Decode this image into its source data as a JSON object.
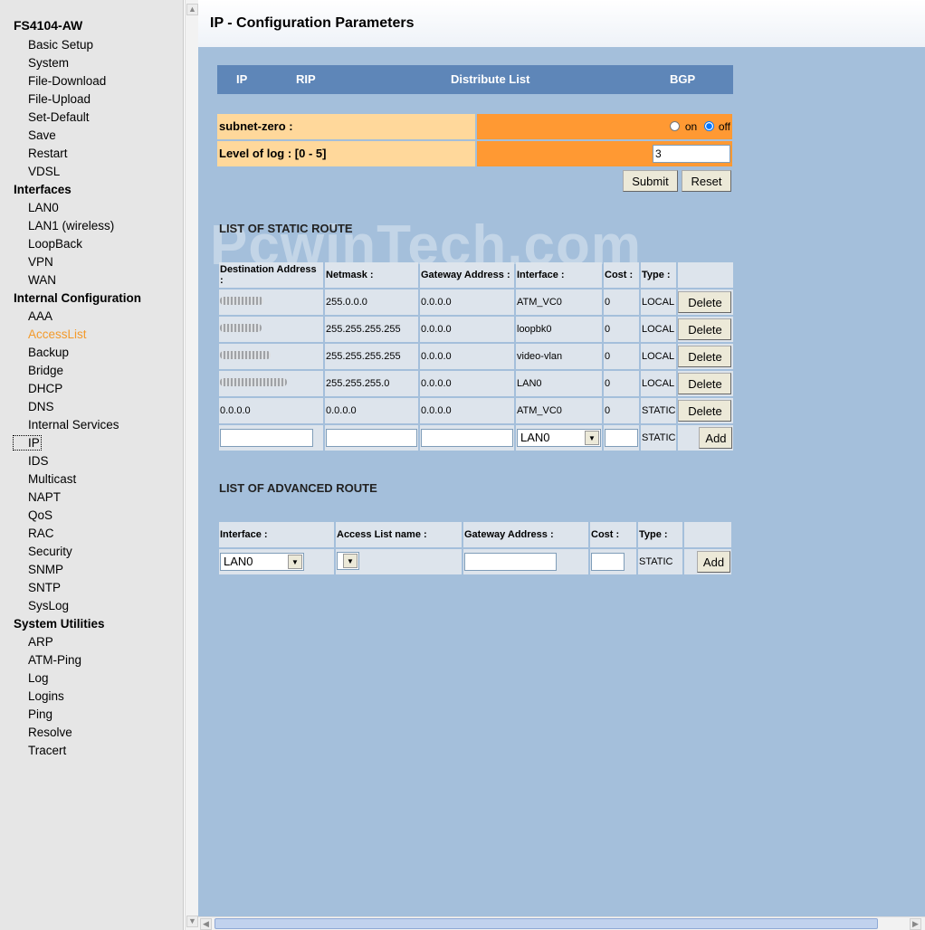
{
  "sidebar": {
    "title": "FS4104-AW",
    "groups": [
      {
        "label": "",
        "items": [
          "Basic Setup",
          "System",
          "File-Download",
          "File-Upload",
          "Set-Default",
          "Save",
          "Restart",
          "VDSL"
        ]
      },
      {
        "label": "Interfaces",
        "items": [
          "LAN0",
          "LAN1 (wireless)",
          "LoopBack",
          "VPN",
          "WAN"
        ]
      },
      {
        "label": "Internal Configuration",
        "items": [
          "AAA",
          "AccessList",
          "Backup",
          "Bridge",
          "DHCP",
          "DNS",
          "Internal Services",
          "IP",
          "IDS",
          "Multicast",
          "NAPT",
          "QoS",
          "RAC",
          "Security",
          "SNMP",
          "SNTP",
          "SysLog"
        ]
      },
      {
        "label": "System Utilities",
        "items": [
          "ARP",
          "ATM-Ping",
          "Log",
          "Logins",
          "Ping",
          "Resolve",
          "Tracert"
        ]
      }
    ],
    "active_item": "AccessList",
    "focused_item": "IP"
  },
  "page": {
    "title": "IP - Configuration Parameters"
  },
  "tabs": [
    "IP",
    "RIP",
    "Distribute List",
    "BGP"
  ],
  "config": {
    "subnet_zero_label": "subnet-zero :",
    "on_label": "on",
    "off_label": "off",
    "subnet_zero_value": "off",
    "log_label": "Level of log : [0 - 5]",
    "log_value": "3",
    "submit_label": "Submit",
    "reset_label": "Reset"
  },
  "watermark": "PcwinTech.com",
  "static_route": {
    "heading": "LIST OF STATIC ROUTE",
    "headers": [
      "Destination Address :",
      "Netmask :",
      "Gateway Address :",
      "Interface :",
      "Cost :",
      "Type :"
    ],
    "rows": [
      {
        "dest": "",
        "netmask": "255.0.0.0",
        "gateway": "0.0.0.0",
        "interface": "ATM_VC0",
        "cost": "0",
        "type": "LOCAL"
      },
      {
        "dest": "",
        "netmask": "255.255.255.255",
        "gateway": "0.0.0.0",
        "interface": "loopbk0",
        "cost": "0",
        "type": "LOCAL"
      },
      {
        "dest": "",
        "netmask": "255.255.255.255",
        "gateway": "0.0.0.0",
        "interface": "video-vlan",
        "cost": "0",
        "type": "LOCAL"
      },
      {
        "dest": "",
        "netmask": "255.255.255.0",
        "gateway": "0.0.0.0",
        "interface": "LAN0",
        "cost": "0",
        "type": "LOCAL"
      },
      {
        "dest": "0.0.0.0",
        "netmask": "0.0.0.0",
        "gateway": "0.0.0.0",
        "interface": "ATM_VC0",
        "cost": "0",
        "type": "STATIC"
      }
    ],
    "delete_label": "Delete",
    "new_row": {
      "interface": "LAN0",
      "type": "STATIC",
      "add_label": "Add"
    }
  },
  "advanced_route": {
    "heading": "LIST OF ADVANCED ROUTE",
    "headers": [
      "Interface :",
      "Access List name :",
      "Gateway Address :",
      "Cost :",
      "Type :"
    ],
    "new_row": {
      "interface": "LAN0",
      "access_list": "",
      "type": "STATIC",
      "add_label": "Add"
    }
  },
  "colors": {
    "sidebar_bg": "#e6e6e6",
    "main_bg": "#a4bfdb",
    "tab_bar": "#5e86b8",
    "label_cell": "#ffd89b",
    "value_cell": "#ff9933",
    "active_link": "#f39a2b"
  }
}
